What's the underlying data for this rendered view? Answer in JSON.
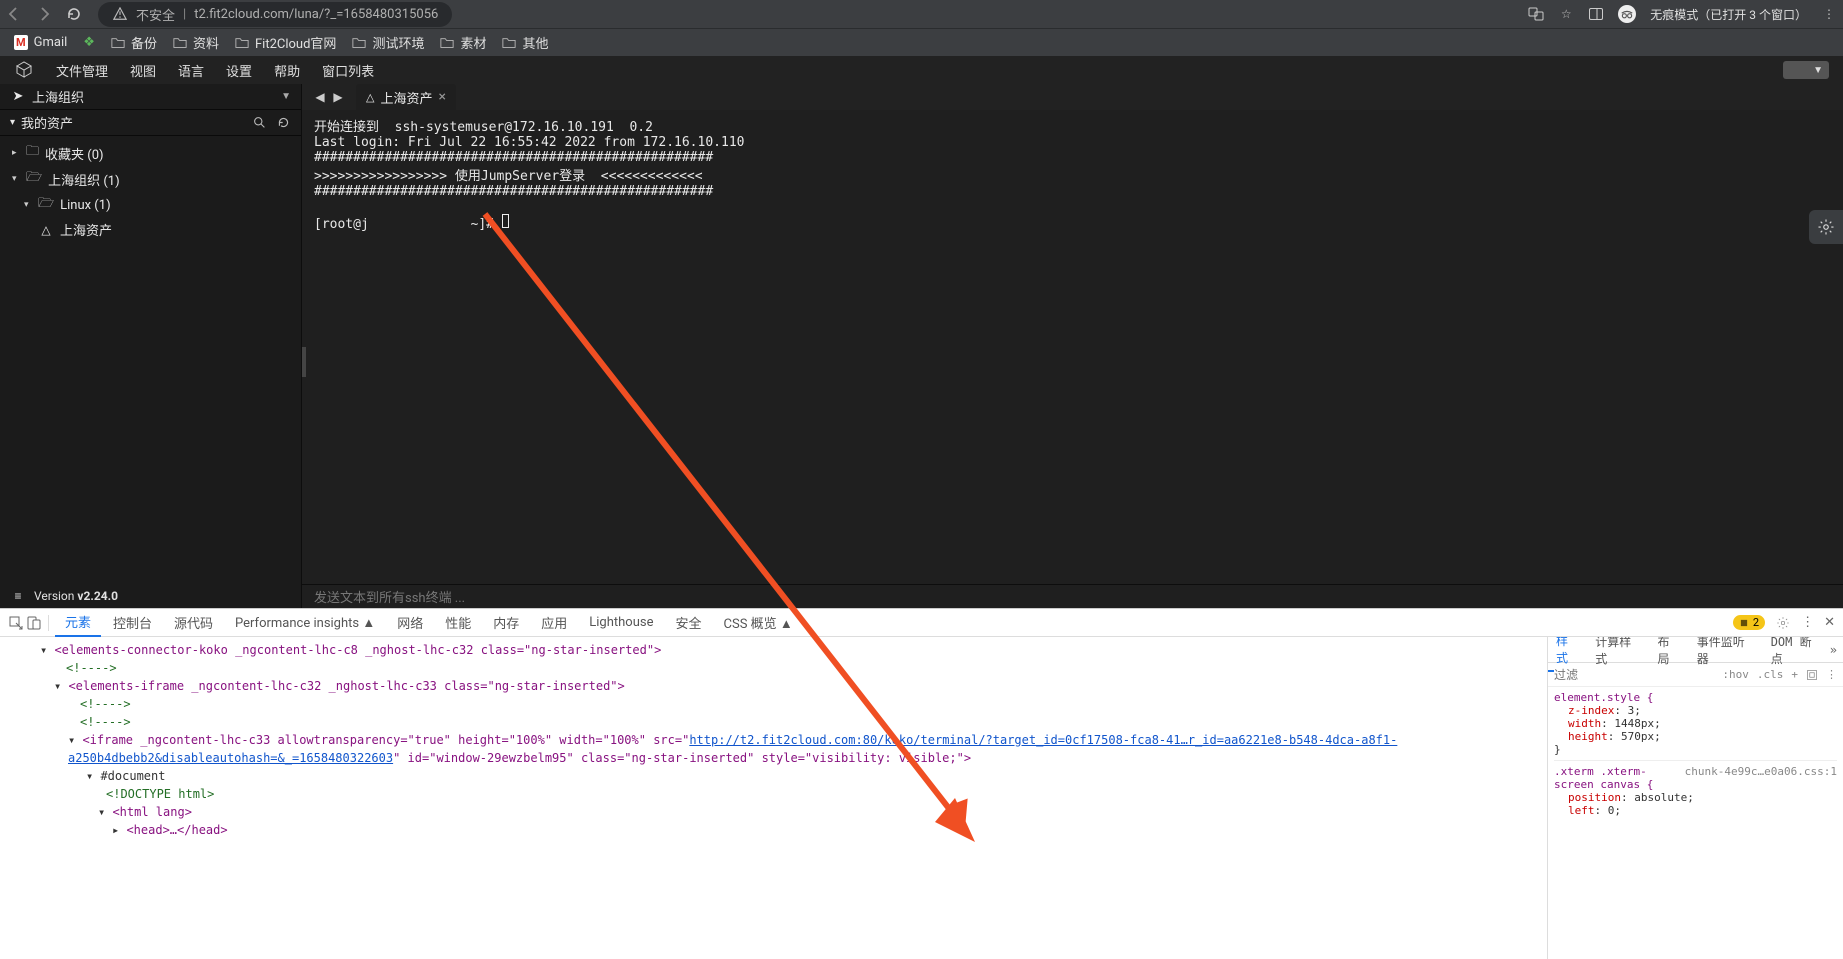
{
  "browser": {
    "security_label": "不安全",
    "url_display": "t2.fit2cloud.com/luna/?_=1658480315056",
    "incognito_label": "无痕模式（已打开 3 个窗口）"
  },
  "bookmarks": [
    {
      "icon": "gmail",
      "label": "Gmail"
    },
    {
      "icon": "green",
      "label": ""
    },
    {
      "icon": "folder",
      "label": "备份"
    },
    {
      "icon": "folder",
      "label": "资料"
    },
    {
      "icon": "folder",
      "label": "Fit2Cloud官网"
    },
    {
      "icon": "folder",
      "label": "测试环境"
    },
    {
      "icon": "folder",
      "label": "素材"
    },
    {
      "icon": "folder",
      "label": "其他"
    }
  ],
  "app_menu": {
    "items": [
      "文件管理",
      "视图",
      "语言",
      "设置",
      "帮助",
      "窗口列表"
    ]
  },
  "sidebar": {
    "org_header": "上海组织",
    "assets_header": "我的资产",
    "tree": {
      "favorites": "收藏夹 (0)",
      "org": "上海组织 (1)",
      "linux": "Linux (1)",
      "asset": "上海资产"
    },
    "version_label": "Version",
    "version_value": "v2.24.0"
  },
  "terminal": {
    "tab_label": "上海资产",
    "lines": [
      "开始连接到  ssh-systemuser@172.16.10.191  0.2",
      "Last login: Fri Jul 22 16:55:42 2022 from 172.16.10.110",
      "###################################################",
      ">>>>>>>>>>>>>>>>> 使用JumpServer登录  <<<<<<<<<<<<<",
      "###################################################",
      "",
      "[root@j             ~]# "
    ],
    "input_placeholder": "发送文本到所有ssh终端 ..."
  },
  "devtools": {
    "tabs": [
      "元素",
      "控制台",
      "源代码",
      "Performance insights ▲",
      "网络",
      "性能",
      "内存",
      "应用",
      "Lighthouse",
      "安全",
      "CSS 概览 ▲"
    ],
    "active_tab": "元素",
    "issues_count": "2",
    "styles_tabs": [
      "样式",
      "计算样式",
      "布局",
      "事件监听器",
      "DOM 断点"
    ],
    "styles_active": "样式",
    "filter_placeholder": "过滤",
    "hov": ":hov",
    "cls": ".cls",
    "elements": {
      "l1_open": "<elements-connector-koko _ngcontent-lhc-c8 _nghost-lhc-c32 class=\"ng-star-inserted\">",
      "cmt1": "<!---->",
      "l2_open": "<elements-iframe _ngcontent-lhc-c32 _nghost-lhc-c33 class=\"ng-star-inserted\">",
      "cmt2": "<!---->",
      "cmt3": "<!---->",
      "iframe_pre": "<iframe _ngcontent-lhc-c33 allowtransparency=\"true\" height=\"100%\" width=\"100%\" src=\"",
      "iframe_url": "http://t2.fit2cloud.com:80/koko/terminal/?target_id=0cf17508-fca8-41…r_id=aa6221e8-b548-4dca-a8f1-a250b4dbebb2&disableautohash=&_=1658480322603",
      "iframe_post": "\" id=\"window-29ewzbelm95\" class=\"ng-star-inserted\" style=\"visibility: visible;\">",
      "doc": "#document",
      "doctype": "<!DOCTYPE html>",
      "html_tag": "<html lang>",
      "head_tag": "<head>…</head>"
    },
    "styles_rules": {
      "element_style": "element.style {",
      "r1": "z-index: 3;",
      "r2": "width: 1448px;",
      "r3": "height: 570px;",
      "close1": "}",
      "source2": "chunk-4e99c…e0a06.css:1",
      "sel2": ".xterm .xterm-screen canvas {",
      "r4": "position: absolute;",
      "r5": "left: 0;"
    }
  }
}
